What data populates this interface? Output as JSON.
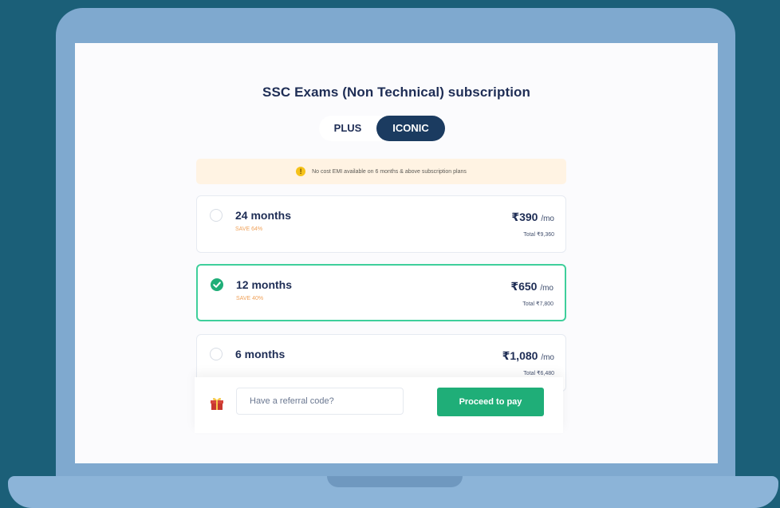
{
  "page": {
    "title": "SSC Exams (Non Technical) subscription"
  },
  "toggle": {
    "options": [
      {
        "label": "PLUS",
        "active": false
      },
      {
        "label": "ICONIC",
        "active": true
      }
    ]
  },
  "notice": {
    "text": "No cost EMI available on 6 months & above subscription plans"
  },
  "plans": [
    {
      "name": "24 months",
      "save": "SAVE 64%",
      "price": "₹390",
      "unit": "/mo",
      "total": "Total ₹9,360",
      "selected": false
    },
    {
      "name": "12 months",
      "save": "SAVE 40%",
      "price": "₹650",
      "unit": "/mo",
      "total": "Total ₹7,800",
      "selected": true
    },
    {
      "name": "6 months",
      "save": "",
      "price": "₹1,080",
      "unit": "/mo",
      "total": "Total ₹6,480",
      "selected": false
    }
  ],
  "footer": {
    "referral_placeholder": "Have a referral code?",
    "pay_label": "Proceed to pay"
  },
  "colors": {
    "accent_green": "#1fae78",
    "selected_border": "#3fcf9b",
    "toggle_active": "#1b3b60",
    "background": "#1b5f78",
    "save_text": "#f0a25a"
  }
}
